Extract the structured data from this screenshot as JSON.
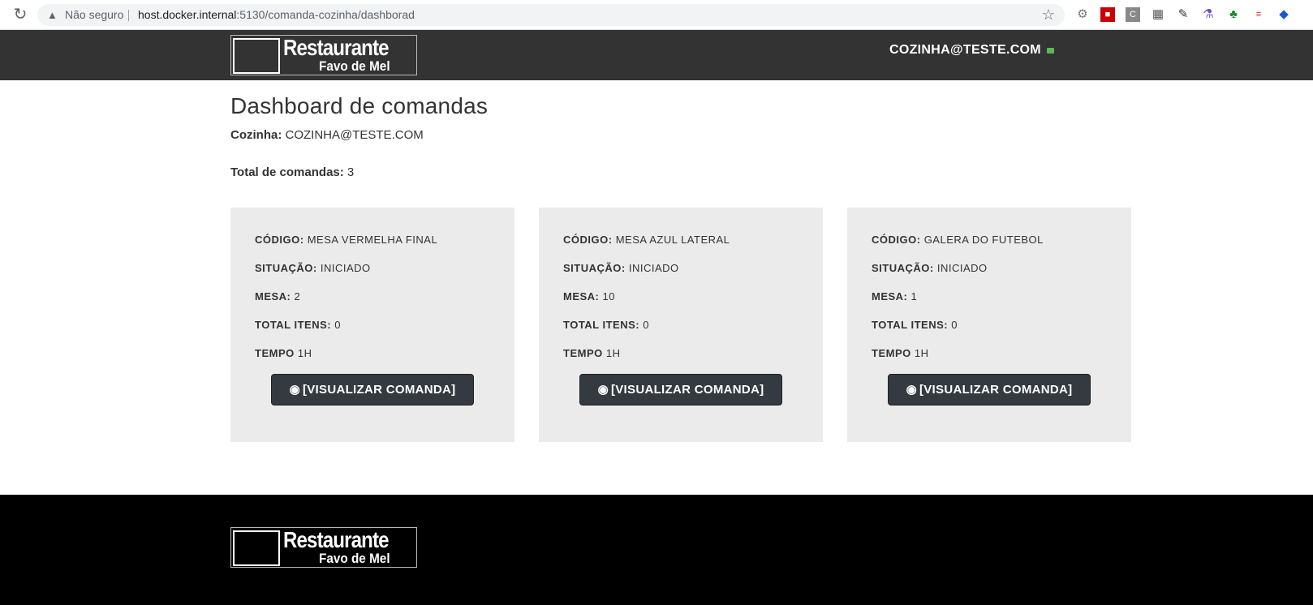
{
  "browser": {
    "not_secure": "Não seguro",
    "url_host": "host.docker.internal",
    "url_path": ":5130/comanda-cozinha/dashborad",
    "icons": [
      "reload-icon",
      "warning-icon",
      "star-icon",
      "settings-icon",
      "pdf-icon",
      "c-icon",
      "grid-icon",
      "pen-icon",
      "flask-icon",
      "clover-icon",
      "translate-icon",
      "diamond-icon"
    ]
  },
  "header": {
    "logo_line1": "Restaurante",
    "logo_line2": "Favo de Mel",
    "user_email": "COZINHA@TESTE.COM"
  },
  "main": {
    "title": "Dashboard de comandas",
    "kitchen_label": "Cozinha:",
    "kitchen_value": "COZINHA@TESTE.COM",
    "total_label": "Total de comandas:",
    "total_value": "3"
  },
  "cards": [
    {
      "codigo_label": "CÓDIGO:",
      "codigo": "MESA VERMELHA FINAL",
      "situacao_label": "SITUAÇÃO:",
      "situacao": "INICIADO",
      "mesa_label": "MESA:",
      "mesa": "2",
      "itens_label": "TOTAL ITENS:",
      "itens": "0",
      "tempo_label": "TEMPO",
      "tempo": "1H",
      "button": "[VISUALIZAR COMANDA]"
    },
    {
      "codigo_label": "CÓDIGO:",
      "codigo": "MESA AZUL LATERAL",
      "situacao_label": "SITUAÇÃO:",
      "situacao": "INICIADO",
      "mesa_label": "MESA:",
      "mesa": "10",
      "itens_label": "TOTAL ITENS:",
      "itens": "0",
      "tempo_label": "TEMPO",
      "tempo": "1H",
      "button": "[VISUALIZAR COMANDA]"
    },
    {
      "codigo_label": "CÓDIGO:",
      "codigo": "GALERA DO FUTEBOL",
      "situacao_label": "SITUAÇÃO:",
      "situacao": "INICIADO",
      "mesa_label": "MESA:",
      "mesa": "1",
      "itens_label": "TOTAL ITENS:",
      "itens": "0",
      "tempo_label": "TEMPO",
      "tempo": "1H",
      "button": "[VISUALIZAR COMANDA]"
    }
  ],
  "footer": {
    "logo_line1": "Restaurante",
    "logo_line2": "Favo de Mel"
  },
  "colors": {
    "header_bg": "#333333",
    "footer_bg": "#000000",
    "card_bg": "#ebebeb",
    "button_bg": "#343a40"
  }
}
